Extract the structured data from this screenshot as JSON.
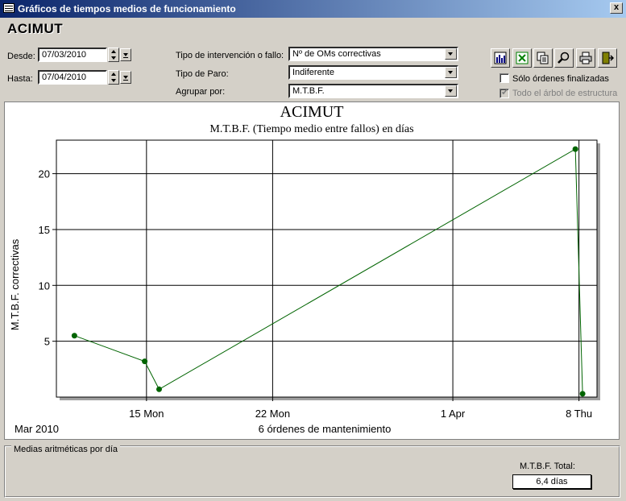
{
  "window": {
    "title": "Gráficos de tiempos medios de funcionamiento",
    "close_label": "x"
  },
  "header": {
    "brand": "ACIMUT"
  },
  "filters": {
    "desde_label": "Desde:",
    "desde_value": "07/03/2010",
    "hasta_label": "Hasta:",
    "hasta_value": "07/04/2010",
    "tipo_intervencion_label": "Tipo de intervención o fallo:",
    "tipo_intervencion_value": "Nº de OMs correctivas",
    "tipo_paro_label": "Tipo de Paro:",
    "tipo_paro_value": "Indiferente",
    "agrupar_label": "Agrupar por:",
    "agrupar_value": "M.T.B.F."
  },
  "toolbar": {
    "buttons": [
      {
        "name": "chart-icon"
      },
      {
        "name": "excel-icon"
      },
      {
        "name": "copy-icon"
      },
      {
        "name": "zoom-icon"
      },
      {
        "name": "print-icon"
      },
      {
        "name": "exit-icon"
      }
    ]
  },
  "options": {
    "solo_finalizadas_label": "Sólo órdenes finalizadas",
    "solo_finalizadas_checked": false,
    "todo_arbol_label": "Todo el árbol de estructura",
    "todo_arbol_checked": true
  },
  "chart_data": {
    "type": "line",
    "title": "ACIMUT",
    "subtitle": "M.T.B.F. (Tiempo medio entre fallos) en días",
    "xlabel": "6 órdenes de mantenimiento",
    "ylabel": "M.T.B.F. correctivas",
    "x_month_label": "Mar 2010",
    "xlim": [
      "2010-03-10",
      "2010-04-09"
    ],
    "ylim": [
      0,
      23
    ],
    "yticks": [
      5,
      10,
      15,
      20
    ],
    "xticks": [
      {
        "date": "2010-03-15",
        "label": "15 Mon"
      },
      {
        "date": "2010-03-22",
        "label": "22 Mon"
      },
      {
        "date": "2010-04-01",
        "label": "1 Apr"
      },
      {
        "date": "2010-04-08",
        "label": "8 Thu"
      }
    ],
    "grid": true,
    "color": "#006400",
    "points": [
      {
        "x": "2010-03-11",
        "y": 5.5
      },
      {
        "x": "2010-03-14.9",
        "y": 3.2
      },
      {
        "x": "2010-03-15.7",
        "y": 0.7
      },
      {
        "x": "2010-04-07.8",
        "y": 22.2
      },
      {
        "x": "2010-04-08.2",
        "y": 0.3
      }
    ]
  },
  "summary": {
    "group_label": "Medias aritméticas por día",
    "total_label": "M.T.B.F. Total:",
    "total_value": "6,4 días"
  }
}
